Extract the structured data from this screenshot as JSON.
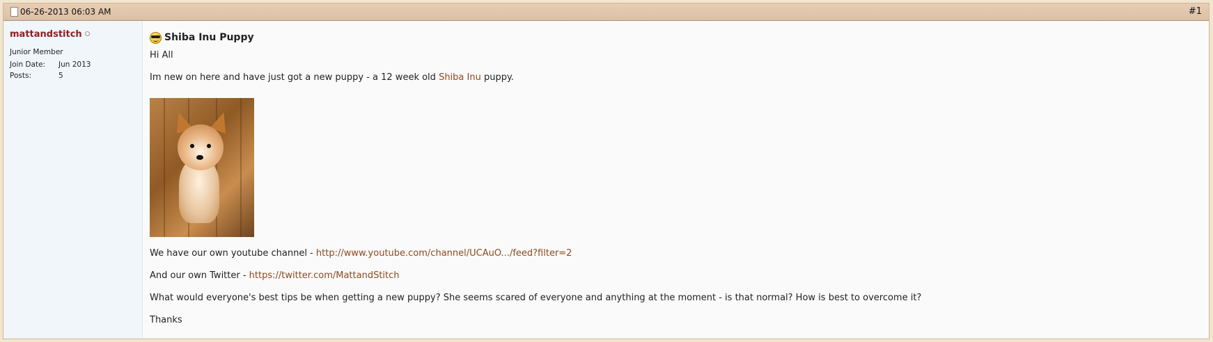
{
  "post": {
    "date": "06-26-2013 06:03 AM",
    "number": "#1"
  },
  "user": {
    "name": "mattandstitch",
    "title": "Junior Member",
    "join_label": "Join Date:",
    "join_value": "Jun 2013",
    "posts_label": "Posts:",
    "posts_value": "5"
  },
  "message": {
    "title": "Shiba Inu Puppy",
    "greeting": "Hi All",
    "intro_before": "Im new on here and have just got a new puppy - a 12 week old ",
    "intro_link": "Shiba Inu",
    "intro_after": " puppy.",
    "youtube_before": "We have our own youtube channel - ",
    "youtube_link": "http://www.youtube.com/channel/UCAuO.../feed?filter=2",
    "twitter_before": "And our own Twitter - ",
    "twitter_link": "https://twitter.com/MattandStitch",
    "question": "What would everyone's best tips be when getting a new puppy? She seems scared of everyone and anything at the moment - is that normal? How is best to overcome it?",
    "closing": "Thanks"
  },
  "icons": {
    "post": "document-icon",
    "title": "sunglasses-smiley-icon",
    "status": "offline-status-icon"
  }
}
